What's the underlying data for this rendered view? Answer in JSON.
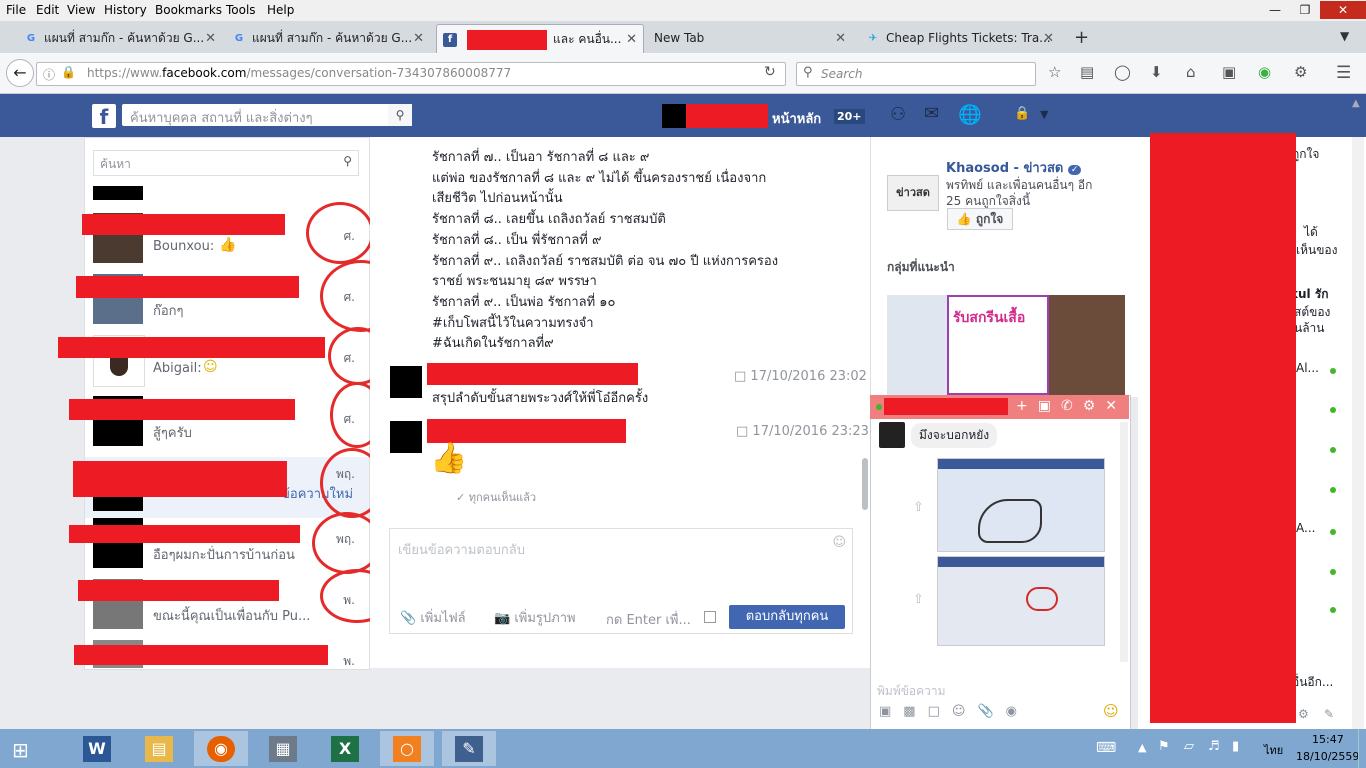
{
  "menubar": {
    "items": [
      "File",
      "Edit",
      "View",
      "History",
      "Bookmarks",
      "Tools",
      "Help"
    ]
  },
  "tabs": [
    {
      "label": "แผนที่ สามก๊ก - ค้นหาด้วย G..."
    },
    {
      "label": "แผนที่ สามก๊ก - ค้นหาด้วย G..."
    },
    {
      "label": "และ คนอื่น..."
    },
    {
      "label": "New Tab"
    },
    {
      "label": "Cheap Flights Tickets: Tra..."
    }
  ],
  "nav": {
    "url_prefix": "https://www.",
    "url_domain": "facebook.com",
    "url_path": "/messages/conversation-734307860008777",
    "search_placeholder": "Search"
  },
  "fb": {
    "search_placeholder": "ค้นหาบุคคล สถานที่ และสิ่งต่างๆ",
    "home_label": "หน้าหลัก",
    "home_count": "20+"
  },
  "left": {
    "search_placeholder": "ค้นหา",
    "conversations": [
      {
        "name": "Bounxou:",
        "date": "ศ."
      },
      {
        "name": "ก๊อกๆ",
        "date": "ศ."
      },
      {
        "name": "Abigail:",
        "date": "ศ."
      },
      {
        "name": "สู้ๆครับ",
        "date": "ศ."
      },
      {
        "name": "ข้อความใหม่",
        "date": "พฤ."
      },
      {
        "name": "อือๆผมกะปั่นการบ้านก่อน",
        "date": "พฤ."
      },
      {
        "name": "ขณะนี้คุณเป็นเพื่อนกับ Pu...",
        "date": "พ."
      },
      {
        "name": "",
        "date": "พ."
      }
    ]
  },
  "thread": {
    "lines": [
      "รัชกาลที่ ๗.. เป็นอา รัชกาลที่ ๘ และ ๙",
      "แต่พ่อ ของรัชกาลที่ ๘ และ ๙ ไม่ได้ ขึ้นครองราชย์ เนื่องจาก",
      "เสียชีวิต ไปก่อนหน้านั้น",
      "รัชกาลที่ ๘.. เลยขึ้น เถลิงถวัลย์ ราชสมบัติ",
      "รัชกาลที่ ๘.. เป็น พี่รัชกาลที่ ๙",
      "รัชกาลที่ ๙.. เถลิงถวัลย์ ราชสมบัติ ต่อ จน ๗๐ ปี แห่งการครอง",
      "ราชย์ พระชนมายุ ๘๙ พรรษา",
      "รัชกาลที่ ๙.. เป็นพ่อ รัชกาลที่ ๑๐",
      "#เก็บโพสนี้ไว้ในความทรงจำ",
      "#ฉันเกิดในรัชกาลที่๙"
    ],
    "msg2_text": "สรุปลำดับขั้นสายพระวงศ์ให้พี่โอ๋อีกครั้ง",
    "msg2_time": "17/10/2016 23:02",
    "msg3_time": "17/10/2016 23:23",
    "seen": "ทุกคนเห็นแล้ว",
    "reply_placeholder": "เขียนข้อความตอบกลับ",
    "add_file": "เพิ่มไฟล์",
    "add_photo": "เพิ่มรูปภาพ",
    "enter_hint": "กด Enter เพื่...",
    "reply_all": "ตอบกลับทุกคน"
  },
  "rightcol": {
    "page_name": "Khaosod - ข่าวสด",
    "page_logo": "ข่าวสด",
    "friends_line1": "พรทิพย์ และเพื่อนคนอื่นๆ อีก",
    "friends_line2": "25 คนถูกใจสิ่งนี้",
    "like_button": "ถูกใจ",
    "groups_header": "กลุ่มที่แนะนำ",
    "ad_text": "รับสกรีนเสื้อ"
  },
  "chat": {
    "message": "มึงจะบอกหยัง",
    "input_placeholder": "พิมพ์ข้อความ"
  },
  "sidebar_frags": [
    "ถูกใจ",
    "ได้",
    "เห็นของ",
    "kul รัก",
    "สต์ของ",
    "นล้าน",
    "Al...",
    "A...",
    "อื่นอีก..."
  ],
  "clock": {
    "time": "15:47",
    "date": "18/10/2559",
    "lang": "ไทย"
  },
  "taskbar": {
    "apps": [
      "word-icon",
      "explorer-icon",
      "firefox-icon",
      "calculator-icon",
      "excel-icon",
      "pdf-icon",
      "paint-icon"
    ]
  },
  "colors": {
    "fb_blue": "#3b5998",
    "redact": "#ed1c24",
    "taskbar": "#7fa7cf"
  }
}
